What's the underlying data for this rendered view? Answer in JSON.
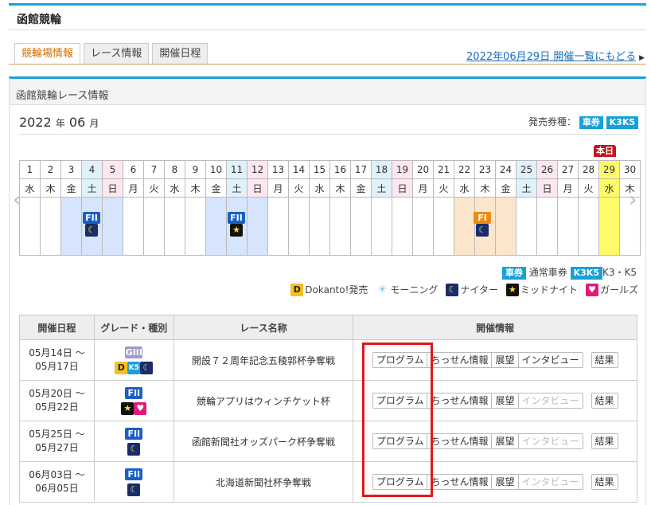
{
  "page": {
    "title": "函館競輪"
  },
  "tabs": [
    {
      "label": "競輪場情報",
      "active": true
    },
    {
      "label": "レース情報",
      "active": false
    },
    {
      "label": "開催日程",
      "active": false
    }
  ],
  "back_link": "2022年06月29日 開催一覧にもどる",
  "panel": {
    "title": "函館競輪レース情報"
  },
  "calendar": {
    "year": "2022",
    "year_unit": "年",
    "month": "06",
    "month_unit": "月",
    "ticket_label": "発売券種：",
    "ticket_badge1": "車券",
    "ticket_badge2": "K3K5",
    "today_label": "本日",
    "days": [
      "1",
      "2",
      "3",
      "4",
      "5",
      "6",
      "7",
      "8",
      "9",
      "10",
      "11",
      "12",
      "13",
      "14",
      "15",
      "16",
      "17",
      "18",
      "19",
      "20",
      "21",
      "22",
      "23",
      "24",
      "25",
      "26",
      "27",
      "28",
      "29",
      "30"
    ],
    "weekdays": [
      "水",
      "木",
      "金",
      "土",
      "日",
      "月",
      "火",
      "水",
      "木",
      "金",
      "土",
      "日",
      "月",
      "火",
      "水",
      "木",
      "金",
      "土",
      "日",
      "月",
      "火",
      "水",
      "木",
      "金",
      "土",
      "日",
      "月",
      "火",
      "水",
      "木"
    ],
    "events": [
      {
        "grade": "FII",
        "icons": [
          "night-icon"
        ]
      },
      {
        "grade": "FII",
        "icons": [
          "midnight-icon"
        ]
      },
      {
        "grade": "FI",
        "icons": [
          "night-icon"
        ]
      }
    ]
  },
  "legend": {
    "kuruma_badge": "車券",
    "kuruma_text": "通常車券",
    "k3k5_badge": "K3K5",
    "k3k5_text": "K3・K5",
    "dokanto": "Dokanto!発売",
    "morning": "モーニング",
    "night": "ナイター",
    "midnight": "ミッドナイト",
    "girls": "ガールズ"
  },
  "schedule": {
    "headers": [
      "開催日程",
      "グレード・種別",
      "レース名称",
      "開催情報"
    ],
    "rows": [
      {
        "date1": "05月14日 ～",
        "date2": "05月17日",
        "grade": "GIII",
        "icons": [
          "dokanto-icon",
          "k5-icon",
          "night-icon"
        ],
        "name": "開設７２周年記念五稜郭杯争奪戦",
        "buttons": [
          {
            "label": "プログラム",
            "enabled": true
          },
          {
            "label": "ちっせん情報",
            "enabled": true
          },
          {
            "label": "展望",
            "enabled": true
          },
          {
            "label": "インタビュー",
            "enabled": true
          }
        ],
        "result": "結果"
      },
      {
        "date1": "05月20日 ～",
        "date2": "05月22日",
        "grade": "FII",
        "icons": [
          "midnight-icon",
          "girls-icon"
        ],
        "name": "競輪アプリはウィンチケット杯",
        "buttons": [
          {
            "label": "プログラム",
            "enabled": true
          },
          {
            "label": "ちっせん情報",
            "enabled": true
          },
          {
            "label": "展望",
            "enabled": true
          },
          {
            "label": "インタビュー",
            "enabled": false
          }
        ],
        "result": "結果"
      },
      {
        "date1": "05月25日 ～",
        "date2": "05月27日",
        "grade": "FII",
        "icons": [
          "night-icon"
        ],
        "name": "函館新聞社オッズパーク杯争奪戦",
        "buttons": [
          {
            "label": "プログラム",
            "enabled": true
          },
          {
            "label": "ちっせん情報",
            "enabled": true
          },
          {
            "label": "展望",
            "enabled": true
          },
          {
            "label": "インタビュー",
            "enabled": false
          }
        ],
        "result": "結果"
      },
      {
        "date1": "06月03日 ～",
        "date2": "06月05日",
        "grade": "FII",
        "icons": [
          "night-icon"
        ],
        "name": "北海道新聞社杯争奪戦",
        "buttons": [
          {
            "label": "プログラム",
            "enabled": true
          },
          {
            "label": "ちっせん情報",
            "enabled": true
          },
          {
            "label": "展望",
            "enabled": true
          },
          {
            "label": "インタビュー",
            "enabled": false
          }
        ],
        "result": "結果"
      }
    ]
  }
}
